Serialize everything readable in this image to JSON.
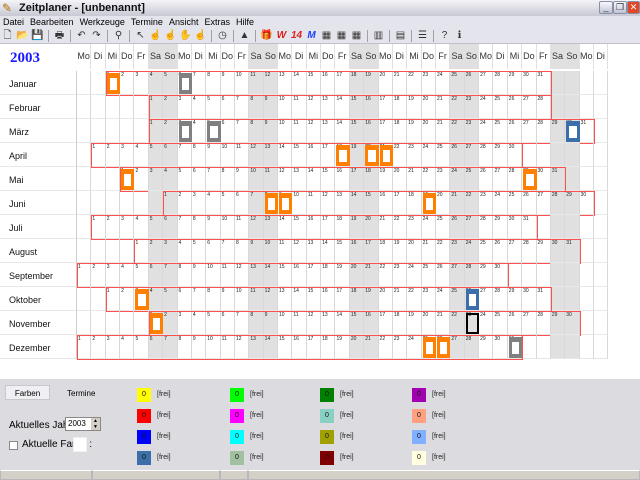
{
  "window": {
    "title": "Zeitplaner - [unbenannt]"
  },
  "menu": [
    "Datei",
    "Bearbeiten",
    "Werkzeuge",
    "Termine",
    "Ansicht",
    "Extras",
    "Hilfe"
  ],
  "toolbar_icons": [
    "new-icon",
    "open-icon",
    "save-icon",
    "|",
    "print-icon",
    "|",
    "undo-icon",
    "redo-icon",
    "|",
    "find-icon",
    "|",
    "pointer-icon",
    "hand-add-icon",
    "hand-remove-icon",
    "hand-icon",
    "hand-delete-icon",
    "|",
    "clock-icon",
    "|",
    "mountain-icon",
    "|",
    "gift-icon",
    "W",
    "14",
    "M",
    "color-grid-icon",
    "color-grid2-icon",
    "color-grid3-icon",
    "|",
    "chart-icon",
    "|",
    "book-icon",
    "|",
    "list-icon",
    "|",
    "help-icon",
    "info-icon"
  ],
  "calendar": {
    "year": "2003",
    "weekdays": [
      "Mo",
      "Di",
      "Mi",
      "Do",
      "Fr",
      "Sa",
      "So"
    ],
    "months": [
      "Januar",
      "Februar",
      "März",
      "April",
      "Mai",
      "Juni",
      "Juli",
      "August",
      "September",
      "Oktober",
      "November",
      "Dezember"
    ],
    "marks": [
      {
        "month": 0,
        "day": 1,
        "color": "#ff8000"
      },
      {
        "month": 0,
        "day": 6,
        "color": "#808080"
      },
      {
        "month": 2,
        "day": 3,
        "color": "#808080"
      },
      {
        "month": 2,
        "day": 5,
        "color": "#808080"
      },
      {
        "month": 2,
        "day": 30,
        "color": "#3c6eaa"
      },
      {
        "month": 3,
        "day": 18,
        "color": "#ff8000"
      },
      {
        "month": 3,
        "day": 20,
        "color": "#ff8000"
      },
      {
        "month": 3,
        "day": 21,
        "color": "#ff8000"
      },
      {
        "month": 4,
        "day": 1,
        "color": "#ff8000"
      },
      {
        "month": 4,
        "day": 29,
        "color": "#ff8000"
      },
      {
        "month": 5,
        "day": 8,
        "color": "#ff8000"
      },
      {
        "month": 5,
        "day": 9,
        "color": "#ff8000"
      },
      {
        "month": 5,
        "day": 19,
        "color": "#ff8000"
      },
      {
        "month": 9,
        "day": 3,
        "color": "#ff8000"
      },
      {
        "month": 9,
        "day": 26,
        "color": "#3c6eaa"
      },
      {
        "month": 10,
        "day": 1,
        "color": "#ff8000"
      },
      {
        "month": 10,
        "day": 23,
        "color": "#000000",
        "outline": true
      },
      {
        "month": 11,
        "day": 25,
        "color": "#ff8000"
      },
      {
        "month": 11,
        "day": 26,
        "color": "#ff8000"
      },
      {
        "month": 11,
        "day": 31,
        "color": "#808080"
      }
    ]
  },
  "panel": {
    "tab_colors": "Farben",
    "tab_appointments": "Termine",
    "year_label": "Aktuelles Jahr :",
    "year_value": "2003",
    "current_color_label": "Aktuelle Farbe :",
    "swatches": [
      [
        {
          "color": "#ffff00",
          "count": "0",
          "label": "[frei]"
        },
        {
          "color": "#00ff00",
          "count": "0",
          "label": "[frei]"
        },
        {
          "color": "#008000",
          "count": "0",
          "label": "[frei]"
        },
        {
          "color": "#a000b0",
          "count": "0",
          "label": "[frei]"
        }
      ],
      [
        {
          "color": "#ff0000",
          "count": "0",
          "label": "[frei]"
        },
        {
          "color": "#ff00ff",
          "count": "0",
          "label": "[frei]"
        },
        {
          "color": "#88d0c4",
          "count": "0",
          "label": "[frei]"
        },
        {
          "color": "#ffa080",
          "count": "0",
          "label": "[frei]"
        }
      ],
      [
        {
          "color": "#0000ff",
          "count": "0",
          "label": "[frei]"
        },
        {
          "color": "#00ffff",
          "count": "0",
          "label": "[frei]"
        },
        {
          "color": "#a0a000",
          "count": "0",
          "label": "[frei]"
        },
        {
          "color": "#80b0ff",
          "count": "0",
          "label": "[frei]"
        }
      ],
      [
        {
          "color": "#3c6eaa",
          "count": "0",
          "label": "[frei]"
        },
        {
          "color": "#a0c0a0",
          "count": "0",
          "label": "[frei]"
        },
        {
          "color": "#800000",
          "count": "0",
          "label": "[frei]"
        },
        {
          "color": "#ffffe0",
          "count": "0",
          "label": "[frei]"
        }
      ]
    ]
  }
}
